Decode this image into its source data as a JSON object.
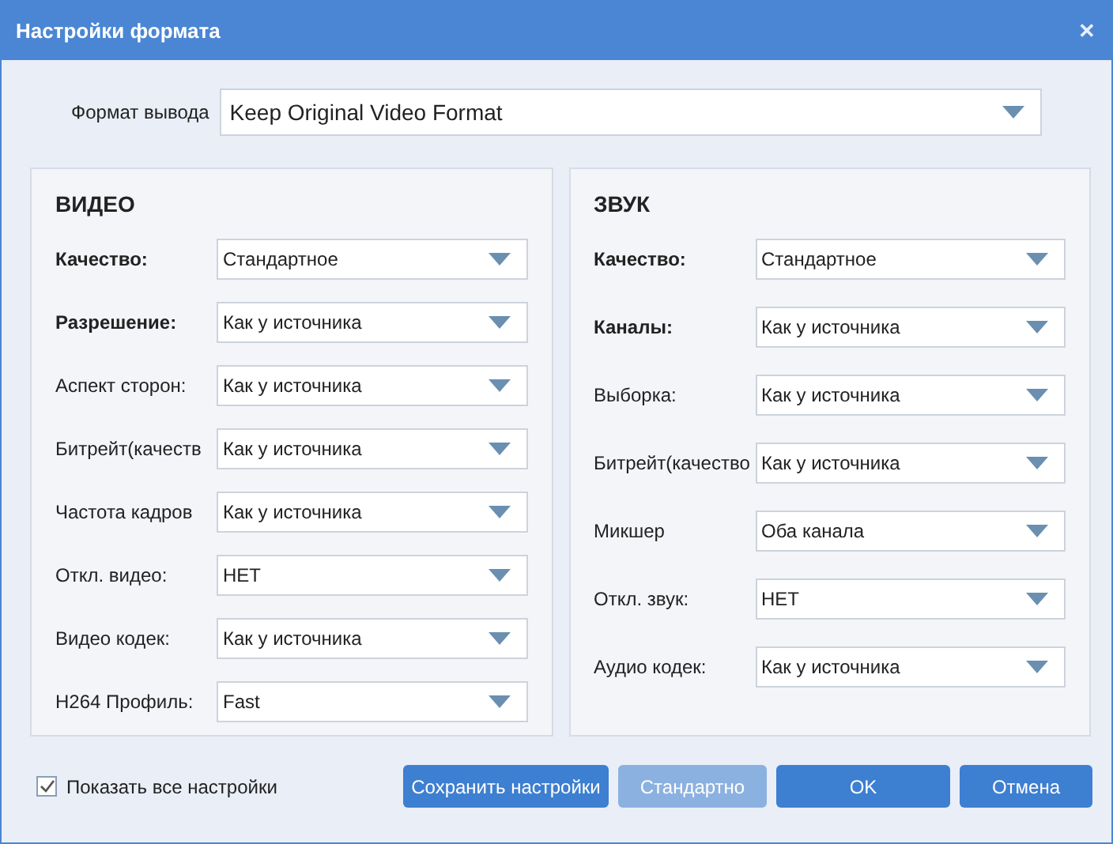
{
  "window": {
    "title": "Настройки формата",
    "close": "✕"
  },
  "output_format": {
    "label": "Формат вывода",
    "value": "Keep Original Video Format"
  },
  "sections": [
    {
      "title": "ВИДЕО",
      "rows": [
        {
          "label": "Качество:",
          "bold": true,
          "value": "Стандартное"
        },
        {
          "label": "Разрешение:",
          "bold": true,
          "value": "Как у источника"
        },
        {
          "label": "Аспект сторон:",
          "bold": false,
          "value": "Как у источника"
        },
        {
          "label": "Битрейт(качеств",
          "bold": false,
          "value": "Как у источника"
        },
        {
          "label": "Частота кадров",
          "bold": false,
          "value": "Как у источника"
        },
        {
          "label": "Откл. видео:",
          "bold": false,
          "value": "НЕТ"
        },
        {
          "label": "Видео кодек:",
          "bold": false,
          "value": "Как у источника"
        },
        {
          "label": "H264 Профиль:",
          "bold": false,
          "value": "Fast"
        }
      ]
    },
    {
      "title": "ЗВУК",
      "rows": [
        {
          "label": "Качество:",
          "bold": true,
          "value": "Стандартное"
        },
        {
          "label": "Каналы:",
          "bold": true,
          "value": "Как у источника"
        },
        {
          "label": "Выборка:",
          "bold": false,
          "value": "Как у источника"
        },
        {
          "label": "Битрейт(качество",
          "bold": false,
          "value": "Как у источника"
        },
        {
          "label": "Микшер",
          "bold": false,
          "value": "Оба канала"
        },
        {
          "label": "Откл. звук:",
          "bold": false,
          "value": "НЕТ"
        },
        {
          "label": "Аудио кодек:",
          "bold": false,
          "value": "Как у источника"
        }
      ]
    }
  ],
  "show_all": {
    "label": "Показать все настройки",
    "checked": true
  },
  "buttons": [
    {
      "label": "Сохранить настройки",
      "disabled": false
    },
    {
      "label": "Стандартно",
      "disabled": true
    },
    {
      "label": "OK",
      "disabled": false
    },
    {
      "label": "Отмена",
      "disabled": false
    }
  ]
}
